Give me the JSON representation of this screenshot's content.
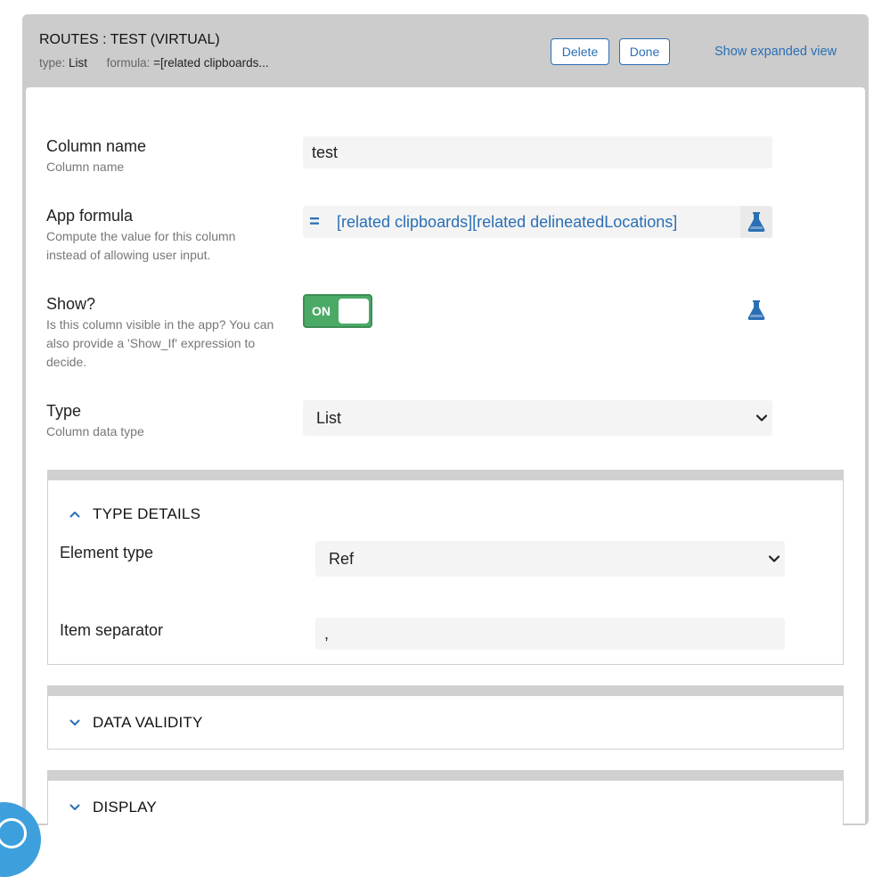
{
  "header": {
    "title": "ROUTES : TEST (VIRTUAL)",
    "type_label": "type:",
    "type_value": "List",
    "formula_label": "formula:",
    "formula_value": "=[related clipboards...",
    "delete_label": "Delete",
    "done_label": "Done",
    "expanded_label": "Show expanded view"
  },
  "fields": {
    "column_name": {
      "label": "Column name",
      "help": "Column name",
      "value": "test"
    },
    "app_formula": {
      "label": "App formula",
      "help": "Compute the value for this column instead of allowing user input.",
      "prefix": "=",
      "value": "[related clipboards][related delineatedLocations]"
    },
    "show": {
      "label": "Show?",
      "help": "Is this column visible in the app? You can also provide a 'Show_If' expression to decide.",
      "toggle_label": "ON",
      "on": true
    },
    "type": {
      "label": "Type",
      "help": "Column data type",
      "value": "List"
    }
  },
  "sections": {
    "type_details": {
      "title": "TYPE DETAILS",
      "expanded": true,
      "element_type_label": "Element type",
      "element_type_value": "Ref",
      "item_separator_label": "Item separator",
      "item_separator_value": ","
    },
    "data_validity": {
      "title": "DATA VALIDITY",
      "expanded": false
    },
    "display": {
      "title": "DISPLAY",
      "expanded": false
    }
  },
  "icons": {
    "test": "flask-icon",
    "expand": "chevron-down-icon",
    "collapse": "chevron-up-icon",
    "help": "help-bubble-icon"
  },
  "colors": {
    "accent": "#2a6fb5",
    "toggle_on": "#4caa67",
    "panel_bg": "#cccccc",
    "input_bg": "#f4f4f4",
    "help_bubble": "#3da0dc"
  }
}
